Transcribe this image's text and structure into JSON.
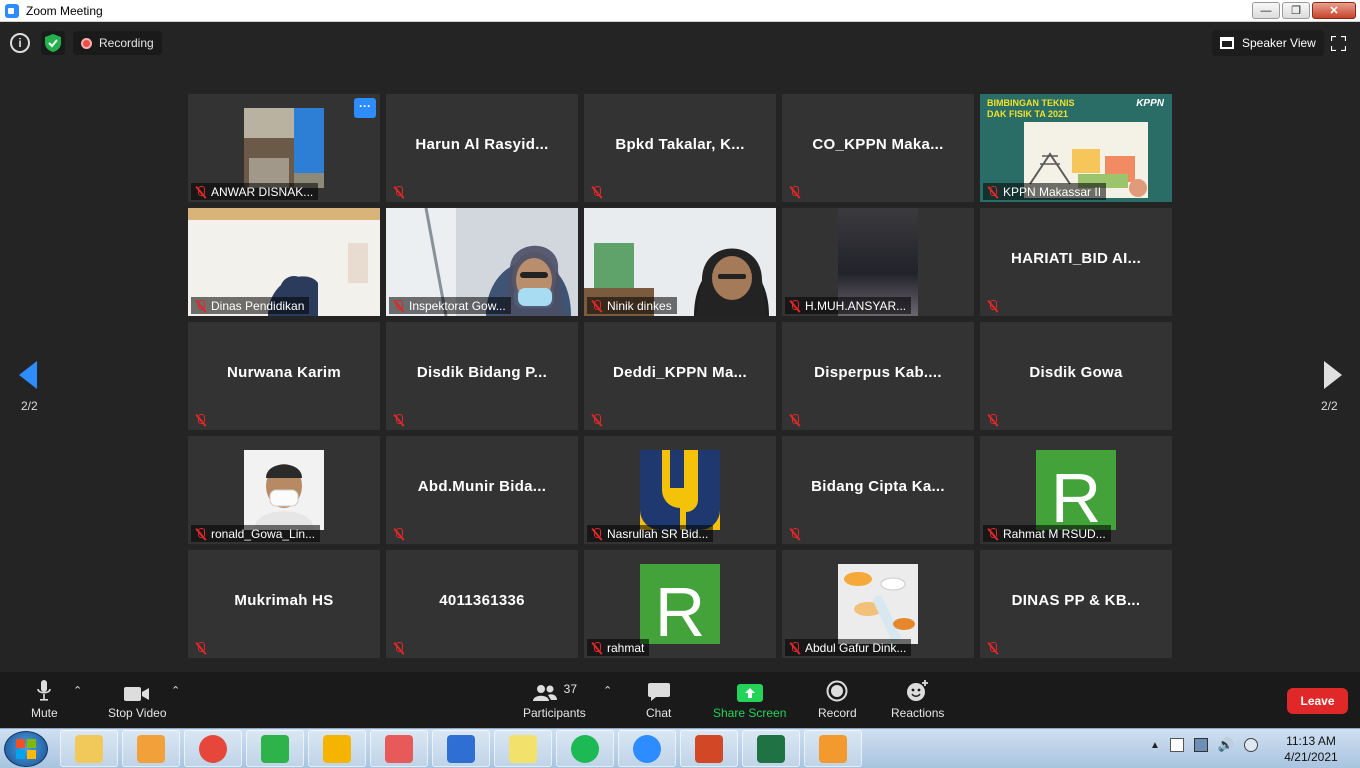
{
  "window": {
    "title": "Zoom Meeting"
  },
  "topbar": {
    "recording_label": "Recording",
    "speaker_view_label": "Speaker View"
  },
  "pager": {
    "left": "2/2",
    "right": "2/2"
  },
  "tiles": [
    {
      "name": "",
      "label": "ANWAR DISNAK...",
      "photo": "outdoor-photo",
      "has_menu": true
    },
    {
      "name": "Harun Al Rasyid...",
      "label": ""
    },
    {
      "name": "Bpkd Takalar, K...",
      "label": ""
    },
    {
      "name": "CO_KPPN Maka...",
      "label": ""
    },
    {
      "name": "",
      "label": "KPPN Makassar II",
      "photo": "presentation",
      "active": true
    },
    {
      "name": "",
      "label": "Dinas Pendidikan",
      "photo": "video-room"
    },
    {
      "name": "",
      "label": "Inspektorat Gow...",
      "photo": "video-woman-mask"
    },
    {
      "name": "",
      "label": "Ninik dinkes",
      "photo": "video-woman"
    },
    {
      "name": "",
      "label": "H.MUH.ANSYAR...",
      "photo": "video-dark"
    },
    {
      "name": "HARIATI_BID AI...",
      "label": ""
    },
    {
      "name": "Nurwana Karim",
      "label": ""
    },
    {
      "name": "Disdik Bidang P...",
      "label": ""
    },
    {
      "name": "Deddi_KPPN Ma...",
      "label": ""
    },
    {
      "name": "Disperpus Kab....",
      "label": ""
    },
    {
      "name": "Disdik Gowa",
      "label": ""
    },
    {
      "name": "",
      "label": "ronald_Gowa_Lin...",
      "photo": "man-mask"
    },
    {
      "name": "Abd.Munir Bida...",
      "label": ""
    },
    {
      "name": "",
      "label": "Nasrullah SR Bid...",
      "photo": "pu-logo"
    },
    {
      "name": "Bidang Cipta Ka...",
      "label": ""
    },
    {
      "name": "",
      "label": "Rahmat M RSUD...",
      "photo": "letter-r"
    },
    {
      "name": "Mukrimah HS",
      "label": ""
    },
    {
      "name": "4011361336",
      "label": ""
    },
    {
      "name": "",
      "label": "rahmat",
      "photo": "letter-r"
    },
    {
      "name": "",
      "label": "Abdul Gafur Dink...",
      "photo": "pills"
    },
    {
      "name": "DINAS PP & KB...",
      "label": ""
    }
  ],
  "presentation": {
    "line1": "BIMBINGAN TEKNIS",
    "line2": "DAK FISIK TA 2021",
    "logo": "KPPN",
    "avatar_letter": "R"
  },
  "toolbar": {
    "mute": "Mute",
    "stop_video": "Stop Video",
    "participants": "Participants",
    "participant_count": "37",
    "chat": "Chat",
    "share_screen": "Share Screen",
    "record": "Record",
    "reactions": "Reactions",
    "leave": "Leave"
  },
  "taskbar": {
    "apps": [
      "explorer",
      "media-player",
      "chrome",
      "app-green",
      "app-s",
      "snipping-tool",
      "app-layers",
      "sticky-notes",
      "spotify",
      "zoom",
      "powerpoint",
      "excel",
      "pdf"
    ],
    "time": "11:13 AM",
    "date": "4/21/2021"
  },
  "colors": {
    "accent": "#2d8cff",
    "active_border": "#f2e12b",
    "leave": "#e02828",
    "share": "#24d35a"
  }
}
